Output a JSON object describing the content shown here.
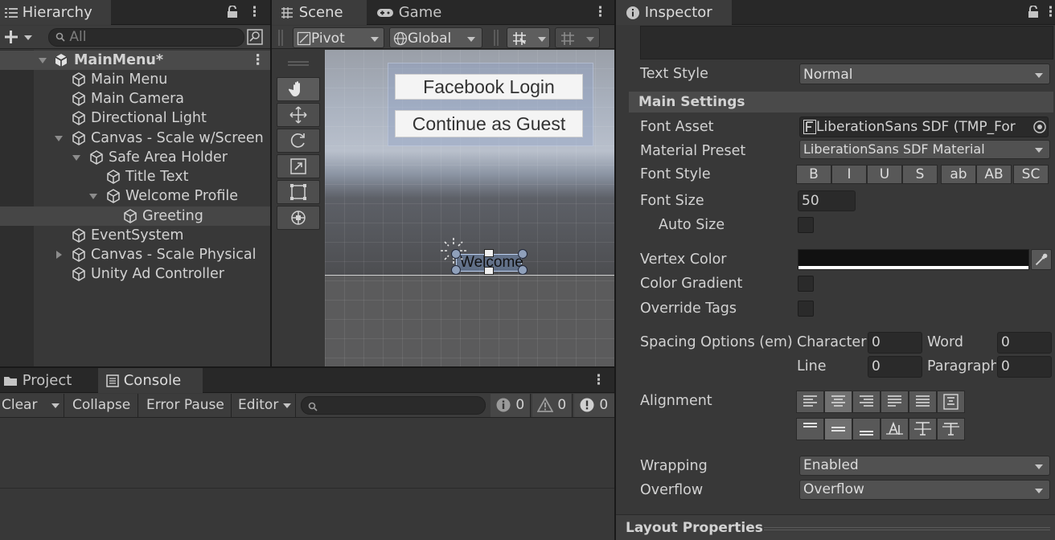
{
  "hierarchy": {
    "tab": "Hierarchy",
    "search_placeholder": "All",
    "scene_name": "MainMenu*",
    "items": [
      {
        "label": "Main Menu"
      },
      {
        "label": "Main Camera"
      },
      {
        "label": "Directional Light"
      },
      {
        "label": "Canvas - Scale w/Screen"
      },
      {
        "label": "Safe Area Holder"
      },
      {
        "label": "Title Text"
      },
      {
        "label": "Welcome Profile"
      },
      {
        "label": "Greeting"
      },
      {
        "label": "EventSystem"
      },
      {
        "label": "Canvas - Scale Physical"
      },
      {
        "label": "Unity Ad Controller"
      }
    ]
  },
  "scene": {
    "tab_scene": "Scene",
    "tab_game": "Game",
    "pivot": "Pivot",
    "global": "Global",
    "facebook_button": "Facebook Login",
    "guest_button": "Continue as Guest",
    "greeting_text": "Welcome"
  },
  "console": {
    "tab_project": "Project",
    "tab_console": "Console",
    "clear": "Clear",
    "collapse": "Collapse",
    "error_pause": "Error Pause",
    "editor": "Editor",
    "info_count": "0",
    "warn_count": "0",
    "error_count": "0"
  },
  "inspector": {
    "tab": "Inspector",
    "text_style_label": "Text Style",
    "text_style_value": "Normal",
    "main_settings": "Main Settings",
    "font_asset_label": "Font Asset",
    "font_asset_value": "LiberationSans SDF (TMP_For",
    "material_preset_label": "Material Preset",
    "material_preset_value": "LiberationSans SDF Material",
    "font_style_label": "Font Style",
    "font_style_buttons": [
      "B",
      "I",
      "U",
      "S",
      "ab",
      "AB",
      "SC"
    ],
    "font_size_label": "Font Size",
    "font_size_value": "50",
    "auto_size_label": "Auto Size",
    "vertex_color_label": "Vertex Color",
    "color_gradient_label": "Color Gradient",
    "override_tags_label": "Override Tags",
    "spacing_label": "Spacing Options (em)",
    "character_label": "Character",
    "character_value": "0",
    "word_label": "Word",
    "word_value": "0",
    "line_label": "Line",
    "line_value": "0",
    "paragraph_label": "Paragraph",
    "paragraph_value": "0",
    "alignment_label": "Alignment",
    "wrapping_label": "Wrapping",
    "wrapping_value": "Enabled",
    "overflow_label": "Overflow",
    "overflow_value": "Overflow",
    "layout_properties": "Layout Properties"
  },
  "colors": {
    "selection": "#464646",
    "panel": "#383838",
    "accent": "#3a72b0"
  }
}
